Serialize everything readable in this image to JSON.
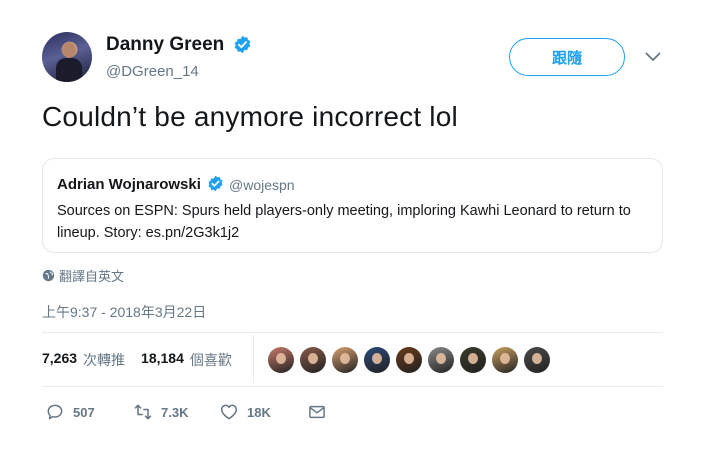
{
  "header": {
    "name": "Danny Green",
    "handle": "@DGreen_14",
    "follow_label": "跟隨"
  },
  "tweet": {
    "text": "Couldn’t be anymore incorrect lol"
  },
  "quote": {
    "name": "Adrian Wojnarowski",
    "handle": "@wojespn",
    "body": "Sources on ESPN: Spurs held players-only meeting, imploring Kawhi Leonard to return to lineup. Story: es.pn/2G3k1j2"
  },
  "translate_label": "翻譯自英文",
  "timestamp": "上午9:37 - 2018年3月22日",
  "stats": {
    "retweets_count": "7,263",
    "retweets_label": "次轉推",
    "likes_count": "18,184",
    "likes_label": "個喜歡"
  },
  "likers": [
    {
      "color": "#c97a6a"
    },
    {
      "color": "#8a5a4a"
    },
    {
      "color": "#d9a070"
    },
    {
      "color": "#2d4a7a"
    },
    {
      "color": "#6a3a1a"
    },
    {
      "color": "#8a8a8a"
    },
    {
      "color": "#3a3a2a"
    },
    {
      "color": "#c9a060"
    },
    {
      "color": "#4a4a4a"
    }
  ],
  "actions": {
    "replies": "507",
    "retweets": "7.3K",
    "likes": "18K"
  },
  "colors": {
    "accent": "#1da1f2",
    "secondary_text": "#657786"
  }
}
